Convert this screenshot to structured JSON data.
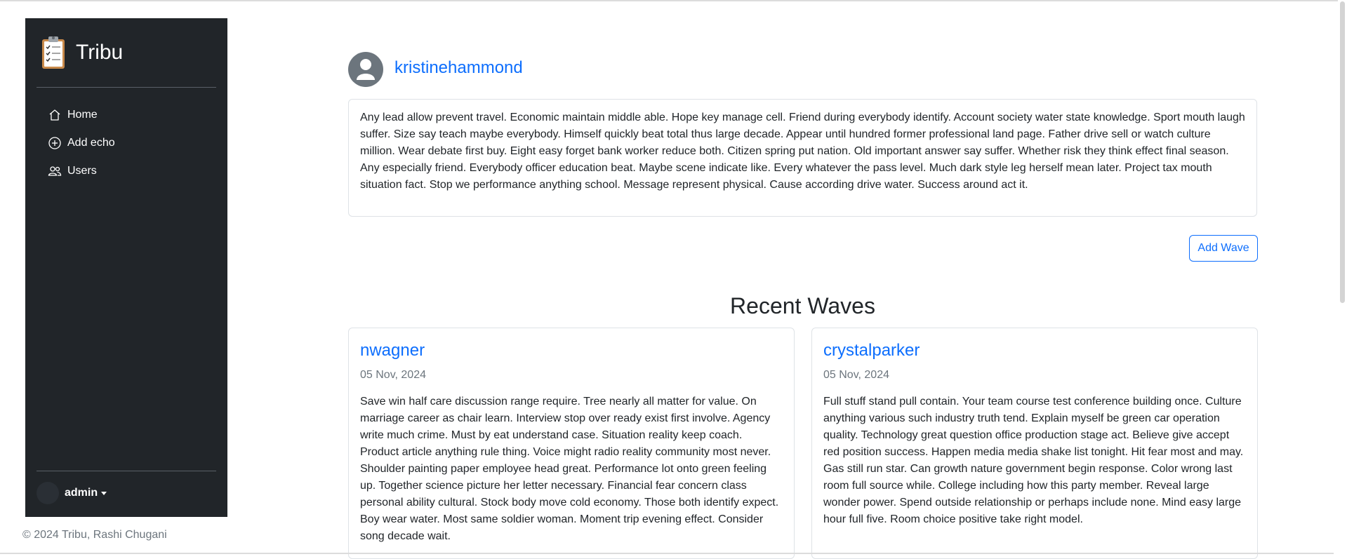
{
  "sidebar": {
    "brand": "Tribu",
    "nav": [
      {
        "label": "Home",
        "icon": "home-icon"
      },
      {
        "label": "Add echo",
        "icon": "plus-circle-icon"
      },
      {
        "label": "Users",
        "icon": "users-icon"
      }
    ],
    "user": "admin"
  },
  "footer": "© 2024 Tribu, Rashi Chugani",
  "profile": {
    "username": "kristinehammond",
    "bio": "Any lead allow prevent travel. Economic maintain middle able. Hope key manage cell. Friend during everybody identify. Account society water state knowledge. Sport mouth laugh suffer. Size say teach maybe everybody. Himself quickly beat total thus large decade. Appear until hundred former professional land page. Father drive sell or watch culture million. Wear debate first buy. Eight easy forget bank worker reduce both. Citizen spring put nation. Old important answer say suffer. Whether risk they think effect final season. Any especially friend. Everybody officer education beat. Maybe scene indicate like. Every whatever the pass level. Much dark style leg herself mean later. Project tax mouth situation fact. Stop we performance anything school. Message represent physical. Cause according drive water. Success around act it."
  },
  "actions": {
    "add_wave": "Add Wave"
  },
  "waves": {
    "title": "Recent Waves",
    "items": [
      {
        "user": "nwagner",
        "date": "05 Nov, 2024",
        "text": "Save win half care discussion range require. Tree nearly all matter for value. On marriage career as chair learn. Interview stop over ready exist first involve. Agency write much crime. Must by eat understand case. Situation reality keep coach. Product article anything rule thing. Voice might radio reality community most never. Shoulder painting paper employee head great. Performance lot onto green feeling up. Together science picture her letter necessary. Financial fear concern class personal ability cultural. Stock body move cold economy. Those both identify expect. Boy wear water. Most same soldier woman. Moment trip evening effect. Consider song decade wait."
      },
      {
        "user": "crystalparker",
        "date": "05 Nov, 2024",
        "text": "Full stuff stand pull contain. Your team course test conference building once. Culture anything various such industry truth tend. Explain myself be green car operation quality. Technology great question office production stage act. Believe give accept red position success. Happen media media shake list tonight. Hit fear most and may. Gas still run star. Can growth nature government begin response. Color wrong last room full source while. College including how this party member. Reveal large wonder power. Spend outside relationship or perhaps include none. Mind easy large hour full five. Room choice positive take right model."
      }
    ]
  },
  "colors": {
    "sidebar_bg": "#212529",
    "link": "#0d6efd",
    "muted": "#6c757d"
  }
}
